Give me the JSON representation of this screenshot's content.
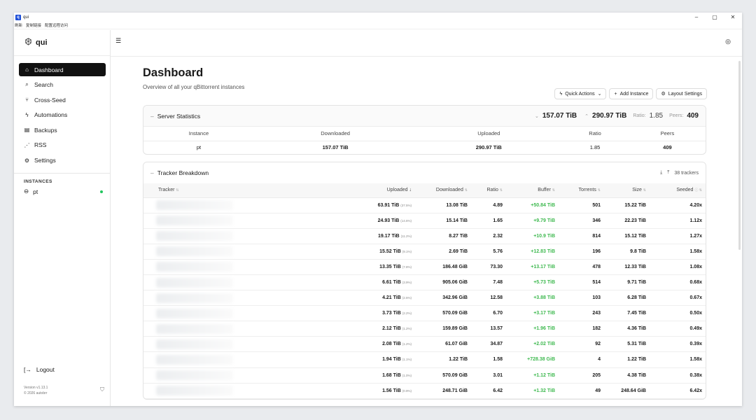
{
  "window": {
    "app_title": "qui",
    "menu": [
      "刷新",
      "复制链接",
      "配置远程访问"
    ],
    "controls": [
      "–",
      "▢",
      "✕"
    ]
  },
  "sidebar": {
    "brand": "qui",
    "items": [
      {
        "label": "Dashboard",
        "icon": "home-icon",
        "glyph": "⌂"
      },
      {
        "label": "Search",
        "icon": "search-icon",
        "glyph": "⌕"
      },
      {
        "label": "Cross-Seed",
        "icon": "branch-icon",
        "glyph": "⑂"
      },
      {
        "label": "Automations",
        "icon": "zap-icon",
        "glyph": "ϟ"
      },
      {
        "label": "Backups",
        "icon": "archive-icon",
        "glyph": "▤"
      },
      {
        "label": "RSS",
        "icon": "rss-icon",
        "glyph": "⋰"
      },
      {
        "label": "Settings",
        "icon": "gear-icon",
        "glyph": "⚙"
      }
    ],
    "instances_heading": "INSTANCES",
    "instance": {
      "name": "pt",
      "status_color": "#22c55e"
    },
    "logout": "Logout",
    "version": "Version v1.13.1",
    "copyright": "© 2026 autobrr"
  },
  "header": {
    "title": "Dashboard",
    "subtitle": "Overview of all your qBittorrent instances",
    "actions": {
      "quick": "Quick Actions",
      "add": "Add Instance",
      "layout": "Layout Settings"
    }
  },
  "server_stats": {
    "title": "Server Statistics",
    "downloaded": "157.07 TiB",
    "uploaded": "290.97 TiB",
    "ratio_label": "Ratio:",
    "ratio": "1.85",
    "peers_label": "Peers:",
    "peers": "409",
    "columns": [
      "Instance",
      "Downloaded",
      "Uploaded",
      "Ratio",
      "Peers"
    ],
    "row": {
      "instance": "pt",
      "downloaded": "157.07 TiB",
      "uploaded": "290.97 TiB",
      "ratio": "1.85",
      "peers": "409"
    }
  },
  "tracker_breakdown": {
    "title": "Tracker Breakdown",
    "count": "38 trackers",
    "columns": [
      "Tracker",
      "Uploaded",
      "Downloaded",
      "Ratio",
      "Buffer",
      "Torrents",
      "Size",
      "Seeded"
    ],
    "rows": [
      {
        "uploaded": "63.91 TiB",
        "pct": "(37.5%)",
        "downloaded": "13.08 TiB",
        "ratio": "4.89",
        "buffer": "+50.84 TiB",
        "torrents": "501",
        "size": "15.22 TiB",
        "seeded": "4.20x"
      },
      {
        "uploaded": "24.93 TiB",
        "pct": "(14.6%)",
        "downloaded": "15.14 TiB",
        "ratio": "1.65",
        "buffer": "+9.79 TiB",
        "torrents": "346",
        "size": "22.23 TiB",
        "seeded": "1.12x"
      },
      {
        "uploaded": "19.17 TiB",
        "pct": "(11.2%)",
        "downloaded": "8.27 TiB",
        "ratio": "2.32",
        "buffer": "+10.9 TiB",
        "torrents": "814",
        "size": "15.12 TiB",
        "seeded": "1.27x"
      },
      {
        "uploaded": "15.52 TiB",
        "pct": "(9.1%)",
        "downloaded": "2.69 TiB",
        "ratio": "5.76",
        "buffer": "+12.83 TiB",
        "torrents": "196",
        "size": "9.8 TiB",
        "seeded": "1.58x"
      },
      {
        "uploaded": "13.35 TiB",
        "pct": "(7.8%)",
        "downloaded": "186.48 GiB",
        "ratio": "73.30",
        "buffer": "+13.17 TiB",
        "torrents": "478",
        "size": "12.33 TiB",
        "seeded": "1.08x"
      },
      {
        "uploaded": "6.61 TiB",
        "pct": "(3.9%)",
        "downloaded": "905.06 GiB",
        "ratio": "7.48",
        "buffer": "+5.73 TiB",
        "torrents": "514",
        "size": "9.71 TiB",
        "seeded": "0.68x"
      },
      {
        "uploaded": "4.21 TiB",
        "pct": "(2.5%)",
        "downloaded": "342.96 GiB",
        "ratio": "12.58",
        "buffer": "+3.88 TiB",
        "torrents": "103",
        "size": "6.28 TiB",
        "seeded": "0.67x"
      },
      {
        "uploaded": "3.73 TiB",
        "pct": "(2.2%)",
        "downloaded": "570.09 GiB",
        "ratio": "6.70",
        "buffer": "+3.17 TiB",
        "torrents": "243",
        "size": "7.45 TiB",
        "seeded": "0.50x"
      },
      {
        "uploaded": "2.12 TiB",
        "pct": "(1.2%)",
        "downloaded": "159.89 GiB",
        "ratio": "13.57",
        "buffer": "+1.96 TiB",
        "torrents": "182",
        "size": "4.36 TiB",
        "seeded": "0.49x"
      },
      {
        "uploaded": "2.08 TiB",
        "pct": "(1.2%)",
        "downloaded": "61.07 GiB",
        "ratio": "34.87",
        "buffer": "+2.02 TiB",
        "torrents": "92",
        "size": "5.31 TiB",
        "seeded": "0.39x"
      },
      {
        "uploaded": "1.94 TiB",
        "pct": "(1.1%)",
        "downloaded": "1.22 TiB",
        "ratio": "1.58",
        "buffer": "+728.38 GiB",
        "torrents": "4",
        "size": "1.22 TiB",
        "seeded": "1.58x"
      },
      {
        "uploaded": "1.68 TiB",
        "pct": "(1.0%)",
        "downloaded": "570.09 GiB",
        "ratio": "3.01",
        "buffer": "+1.12 TiB",
        "torrents": "205",
        "size": "4.38 TiB",
        "seeded": "0.38x"
      },
      {
        "uploaded": "1.56 TiB",
        "pct": "(0.9%)",
        "downloaded": "248.71 GiB",
        "ratio": "6.42",
        "buffer": "+1.32 TiB",
        "torrents": "49",
        "size": "248.64 GiB",
        "seeded": "6.42x"
      }
    ]
  },
  "colors": {
    "accent": "#111111",
    "buffer_positive": "#3fb950",
    "status_online": "#22c55e"
  }
}
